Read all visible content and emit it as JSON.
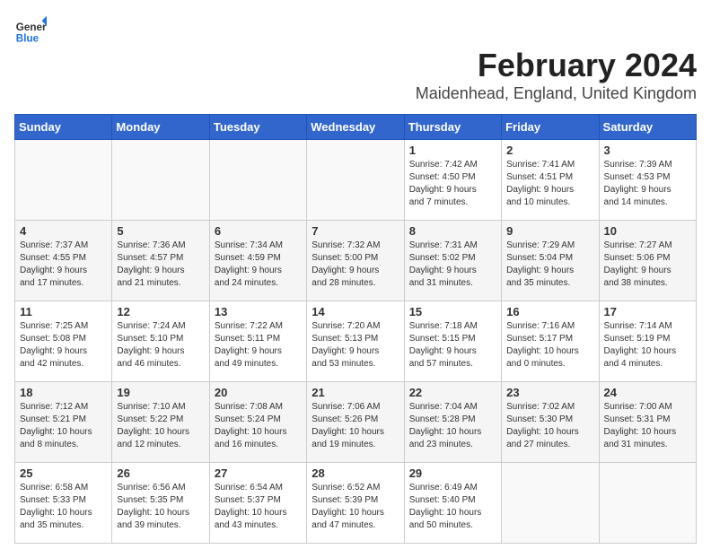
{
  "header": {
    "month_year": "February 2024",
    "location": "Maidenhead, England, United Kingdom",
    "logo_text_general": "General",
    "logo_text_blue": "Blue"
  },
  "days_of_week": [
    "Sunday",
    "Monday",
    "Tuesday",
    "Wednesday",
    "Thursday",
    "Friday",
    "Saturday"
  ],
  "weeks": [
    [
      {
        "day": "",
        "content": ""
      },
      {
        "day": "",
        "content": ""
      },
      {
        "day": "",
        "content": ""
      },
      {
        "day": "",
        "content": ""
      },
      {
        "day": "1",
        "content": "Sunrise: 7:42 AM\nSunset: 4:50 PM\nDaylight: 9 hours\nand 7 minutes."
      },
      {
        "day": "2",
        "content": "Sunrise: 7:41 AM\nSunset: 4:51 PM\nDaylight: 9 hours\nand 10 minutes."
      },
      {
        "day": "3",
        "content": "Sunrise: 7:39 AM\nSunset: 4:53 PM\nDaylight: 9 hours\nand 14 minutes."
      }
    ],
    [
      {
        "day": "4",
        "content": "Sunrise: 7:37 AM\nSunset: 4:55 PM\nDaylight: 9 hours\nand 17 minutes."
      },
      {
        "day": "5",
        "content": "Sunrise: 7:36 AM\nSunset: 4:57 PM\nDaylight: 9 hours\nand 21 minutes."
      },
      {
        "day": "6",
        "content": "Sunrise: 7:34 AM\nSunset: 4:59 PM\nDaylight: 9 hours\nand 24 minutes."
      },
      {
        "day": "7",
        "content": "Sunrise: 7:32 AM\nSunset: 5:00 PM\nDaylight: 9 hours\nand 28 minutes."
      },
      {
        "day": "8",
        "content": "Sunrise: 7:31 AM\nSunset: 5:02 PM\nDaylight: 9 hours\nand 31 minutes."
      },
      {
        "day": "9",
        "content": "Sunrise: 7:29 AM\nSunset: 5:04 PM\nDaylight: 9 hours\nand 35 minutes."
      },
      {
        "day": "10",
        "content": "Sunrise: 7:27 AM\nSunset: 5:06 PM\nDaylight: 9 hours\nand 38 minutes."
      }
    ],
    [
      {
        "day": "11",
        "content": "Sunrise: 7:25 AM\nSunset: 5:08 PM\nDaylight: 9 hours\nand 42 minutes."
      },
      {
        "day": "12",
        "content": "Sunrise: 7:24 AM\nSunset: 5:10 PM\nDaylight: 9 hours\nand 46 minutes."
      },
      {
        "day": "13",
        "content": "Sunrise: 7:22 AM\nSunset: 5:11 PM\nDaylight: 9 hours\nand 49 minutes."
      },
      {
        "day": "14",
        "content": "Sunrise: 7:20 AM\nSunset: 5:13 PM\nDaylight: 9 hours\nand 53 minutes."
      },
      {
        "day": "15",
        "content": "Sunrise: 7:18 AM\nSunset: 5:15 PM\nDaylight: 9 hours\nand 57 minutes."
      },
      {
        "day": "16",
        "content": "Sunrise: 7:16 AM\nSunset: 5:17 PM\nDaylight: 10 hours\nand 0 minutes."
      },
      {
        "day": "17",
        "content": "Sunrise: 7:14 AM\nSunset: 5:19 PM\nDaylight: 10 hours\nand 4 minutes."
      }
    ],
    [
      {
        "day": "18",
        "content": "Sunrise: 7:12 AM\nSunset: 5:21 PM\nDaylight: 10 hours\nand 8 minutes."
      },
      {
        "day": "19",
        "content": "Sunrise: 7:10 AM\nSunset: 5:22 PM\nDaylight: 10 hours\nand 12 minutes."
      },
      {
        "day": "20",
        "content": "Sunrise: 7:08 AM\nSunset: 5:24 PM\nDaylight: 10 hours\nand 16 minutes."
      },
      {
        "day": "21",
        "content": "Sunrise: 7:06 AM\nSunset: 5:26 PM\nDaylight: 10 hours\nand 19 minutes."
      },
      {
        "day": "22",
        "content": "Sunrise: 7:04 AM\nSunset: 5:28 PM\nDaylight: 10 hours\nand 23 minutes."
      },
      {
        "day": "23",
        "content": "Sunrise: 7:02 AM\nSunset: 5:30 PM\nDaylight: 10 hours\nand 27 minutes."
      },
      {
        "day": "24",
        "content": "Sunrise: 7:00 AM\nSunset: 5:31 PM\nDaylight: 10 hours\nand 31 minutes."
      }
    ],
    [
      {
        "day": "25",
        "content": "Sunrise: 6:58 AM\nSunset: 5:33 PM\nDaylight: 10 hours\nand 35 minutes."
      },
      {
        "day": "26",
        "content": "Sunrise: 6:56 AM\nSunset: 5:35 PM\nDaylight: 10 hours\nand 39 minutes."
      },
      {
        "day": "27",
        "content": "Sunrise: 6:54 AM\nSunset: 5:37 PM\nDaylight: 10 hours\nand 43 minutes."
      },
      {
        "day": "28",
        "content": "Sunrise: 6:52 AM\nSunset: 5:39 PM\nDaylight: 10 hours\nand 47 minutes."
      },
      {
        "day": "29",
        "content": "Sunrise: 6:49 AM\nSunset: 5:40 PM\nDaylight: 10 hours\nand 50 minutes."
      },
      {
        "day": "",
        "content": ""
      },
      {
        "day": "",
        "content": ""
      }
    ]
  ]
}
